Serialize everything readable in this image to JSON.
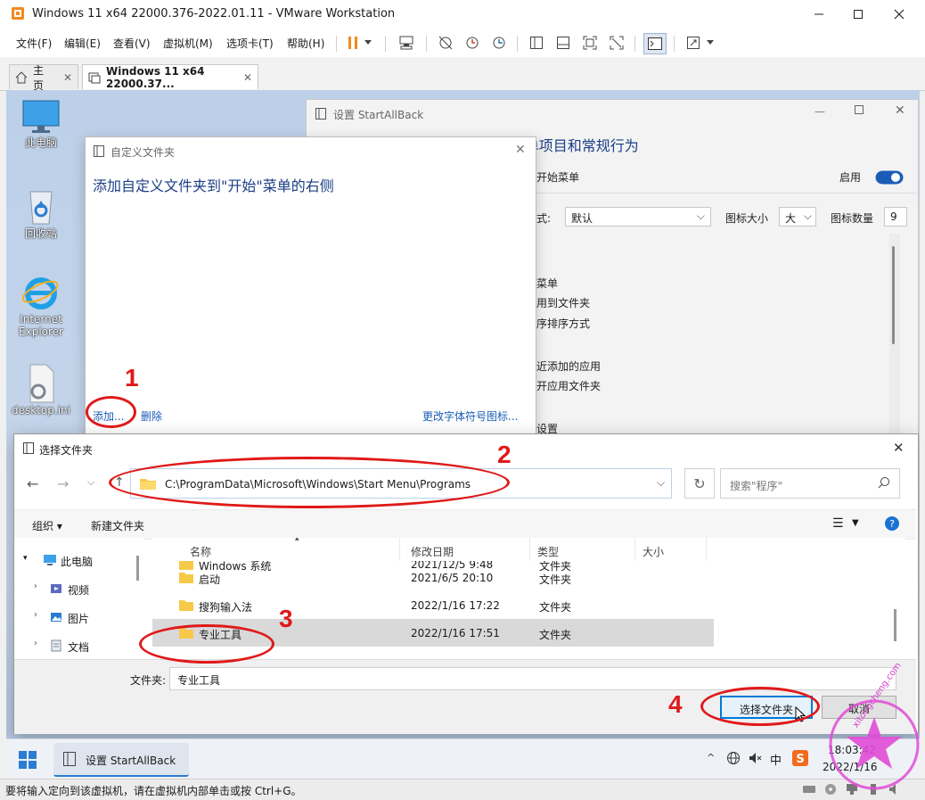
{
  "window": {
    "title": "Windows 11 x64 22000.376-2022.01.11 - VMware Workstation"
  },
  "menubar": {
    "items": [
      "文件(F)",
      "编辑(E)",
      "查看(V)",
      "虚拟机(M)",
      "选项卡(T)",
      "帮助(H)"
    ]
  },
  "tabs": [
    {
      "label": "主页"
    },
    {
      "label": "Windows 11 x64 22000.37..."
    }
  ],
  "desktop": {
    "icons": [
      {
        "label": "此电脑"
      },
      {
        "label": "回收站"
      },
      {
        "label": "Internet Explorer"
      },
      {
        "label": "desktop.ini"
      }
    ]
  },
  "startallback": {
    "title": "设置 StartAllBack",
    "heading": "设置\"开始\"菜单项目和常规行为",
    "start_menu_label": "开始菜单",
    "enable_label": "启用",
    "style_label": "式:",
    "style_value": "默认",
    "icon_size_label": "图标大小",
    "icon_size_value": "大",
    "icon_count_label": "图标数量",
    "icon_count_value": "9",
    "lines": [
      "菜单",
      "用到文件夹",
      "序排序方式",
      "近添加的应用",
      "开应用文件夹",
      "设置"
    ]
  },
  "custom_folders": {
    "title": "自定义文件夹",
    "heading": "添加自定义文件夹到\"开始\"菜单的右侧",
    "add_label": "添加...",
    "delete_label": "删除",
    "change_icon_label": "更改字体符号图标..."
  },
  "folder_picker": {
    "title": "选择文件夹",
    "address": "C:\\ProgramData\\Microsoft\\Windows\\Start Menu\\Programs",
    "search_placeholder": "搜索\"程序\"",
    "organize_label": "组织 ▾",
    "new_folder_label": "新建文件夹",
    "columns": {
      "name": "名称",
      "modified": "修改日期",
      "type": "类型",
      "size": "大小"
    },
    "nav": [
      {
        "label": "此电脑"
      },
      {
        "label": "视频"
      },
      {
        "label": "图片"
      },
      {
        "label": "文档"
      }
    ],
    "rows": [
      {
        "name": "Windows 系统",
        "modified": "2021/12/5 9:48",
        "type": "文件夹"
      },
      {
        "name": "启动",
        "modified": "2021/6/5 20:10",
        "type": "文件夹"
      },
      {
        "name": "搜狗输入法",
        "modified": "2022/1/16 17:22",
        "type": "文件夹"
      },
      {
        "name": "专业工具",
        "modified": "2022/1/16 17:51",
        "type": "文件夹"
      }
    ],
    "folder_label": "文件夹:",
    "folder_value": "专业工具",
    "select_label": "选择文件夹",
    "cancel_label": "取消"
  },
  "taskbar": {
    "app_label": "设置 StartAllBack",
    "ime_label": "中",
    "time": "18:03:42",
    "date": "2022/1/16"
  },
  "statusbar": {
    "text": "要将输入定向到该虚拟机，请在虚拟机内部单击或按 Ctrl+G。"
  },
  "annotations": [
    "1",
    "2",
    "3",
    "4"
  ],
  "watermark": "xitongcheng.com",
  "colors": {
    "annotation": "#e01919",
    "accent": "#0078d7",
    "selection": "#cce8ff",
    "heading": "#1a3e86"
  }
}
